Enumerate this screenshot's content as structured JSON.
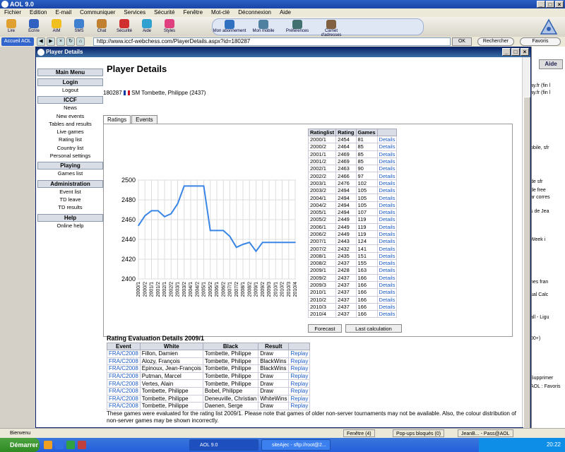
{
  "app": {
    "title": "AOL 9.0"
  },
  "menu": [
    "Fichier",
    "Edition",
    "E-mail",
    "Communiquer",
    "Services",
    "Sécurité",
    "Fenêtre",
    "Mot-clé",
    "Déconnexion",
    "Aide"
  ],
  "toolbar": [
    {
      "label": "Lire",
      "color": "#e0a030"
    },
    {
      "label": "Ecrire",
      "color": "#3060c0"
    },
    {
      "label": "AIM",
      "color": "#f0c020"
    },
    {
      "label": "SMS",
      "color": "#4080d0"
    },
    {
      "label": "Chat",
      "color": "#c08030"
    },
    {
      "label": "Sécurité",
      "color": "#d03030"
    },
    {
      "label": "Aide",
      "color": "#30a0d0"
    },
    {
      "label": "Styles",
      "color": "#e04080"
    }
  ],
  "toolbar2": [
    {
      "label": "Mon abonnement",
      "color": "#3070c0"
    },
    {
      "label": "Mon mobile",
      "color": "#5080a0"
    },
    {
      "label": "Préférences",
      "color": "#407070"
    },
    {
      "label": "Carnet d'adresses",
      "color": "#806040"
    }
  ],
  "address": {
    "accueil": "Accueil AOL",
    "url": "http://www.iccf-webchess.com/PlayerDetails.aspx?id=180287",
    "ok": "OK",
    "search": "Rechercher",
    "favs": "Favoris"
  },
  "window": {
    "title": "Player Details"
  },
  "nav": [
    {
      "type": "header",
      "label": "Main Menu"
    },
    {
      "type": "header",
      "label": "Login"
    },
    {
      "type": "item",
      "label": "Logout"
    },
    {
      "type": "header",
      "label": "ICCF"
    },
    {
      "type": "item",
      "label": "News"
    },
    {
      "type": "item",
      "label": "New events"
    },
    {
      "type": "item",
      "label": "Tables and results"
    },
    {
      "type": "item",
      "label": "Live games"
    },
    {
      "type": "item",
      "label": "Rating list"
    },
    {
      "type": "item",
      "label": "Country list"
    },
    {
      "type": "item",
      "label": "Personal settings"
    },
    {
      "type": "header",
      "label": "Playing"
    },
    {
      "type": "item",
      "label": "Games list"
    },
    {
      "type": "header",
      "label": "Administration"
    },
    {
      "type": "item",
      "label": "Event list"
    },
    {
      "type": "item",
      "label": "TD leave"
    },
    {
      "type": "item",
      "label": "TD results"
    },
    {
      "type": "header",
      "label": "Help"
    },
    {
      "type": "item",
      "label": "Online help"
    }
  ],
  "page": {
    "title": "Player Details",
    "player_id": "180287",
    "player_name": "SM Tombette, Philippe (2437)",
    "tabs": [
      "Ratings",
      "Events"
    ],
    "forecast": "Forecast",
    "last_calc": "Last calculation",
    "eval_title": "Rating Evaluation Details 2009/1",
    "eval_note": "These games were evaluated for the rating list 2009/1. Please note that games of older non-server tournaments may not be available. Also, the colour distribution of non-server games may be shown incorrectly."
  },
  "rating_table": {
    "headers": [
      "Ratinglist",
      "Rating",
      "Games",
      ""
    ],
    "link": "Details",
    "rows": [
      [
        "2000/1",
        "2454",
        "81"
      ],
      [
        "2000/2",
        "2464",
        "85"
      ],
      [
        "2001/1",
        "2469",
        "85"
      ],
      [
        "2001/2",
        "2469",
        "85"
      ],
      [
        "2002/1",
        "2463",
        "90"
      ],
      [
        "2002/2",
        "2466",
        "97"
      ],
      [
        "2003/1",
        "2476",
        "102"
      ],
      [
        "2003/2",
        "2494",
        "105"
      ],
      [
        "2004/1",
        "2494",
        "105"
      ],
      [
        "2004/2",
        "2494",
        "105"
      ],
      [
        "2005/1",
        "2494",
        "107"
      ],
      [
        "2005/2",
        "2449",
        "119"
      ],
      [
        "2006/1",
        "2449",
        "119"
      ],
      [
        "2006/2",
        "2449",
        "119"
      ],
      [
        "2007/1",
        "2443",
        "124"
      ],
      [
        "2007/2",
        "2432",
        "141"
      ],
      [
        "2008/1",
        "2435",
        "151"
      ],
      [
        "2008/2",
        "2437",
        "155"
      ],
      [
        "2009/1",
        "2428",
        "163"
      ],
      [
        "2009/2",
        "2437",
        "166"
      ],
      [
        "2009/3",
        "2437",
        "166"
      ],
      [
        "2010/1",
        "2437",
        "166"
      ],
      [
        "2010/2",
        "2437",
        "166"
      ],
      [
        "2010/3",
        "2437",
        "166"
      ],
      [
        "2010/4",
        "2437",
        "166"
      ]
    ]
  },
  "chart_data": {
    "type": "line",
    "x": [
      "2000/1",
      "2000/2",
      "2001/1",
      "2001/2",
      "2002/1",
      "2002/2",
      "2003/1",
      "2003/2",
      "2004/1",
      "2004/2",
      "2005/1",
      "2005/2",
      "2006/1",
      "2006/2",
      "2007/1",
      "2007/2",
      "2008/1",
      "2008/2",
      "2009/1",
      "2009/2",
      "2009/3",
      "2010/1",
      "2010/2",
      "2010/3",
      "2010/4"
    ],
    "series": [
      {
        "values": [
          2454,
          2464,
          2469,
          2469,
          2463,
          2466,
          2476,
          2494,
          2494,
          2494,
          2494,
          2449,
          2449,
          2449,
          2443,
          2432,
          2435,
          2437,
          2428,
          2437,
          2437,
          2437,
          2437,
          2437,
          2437
        ]
      }
    ],
    "yticks": [
      2400,
      2420,
      2440,
      2460,
      2480,
      2500
    ],
    "ylim": [
      2400,
      2500
    ],
    "grid": true,
    "color": "#3a86e6"
  },
  "eval_table": {
    "headers": [
      "Event",
      "White",
      "Black",
      "Result",
      ""
    ],
    "link": "Replay",
    "rows": [
      [
        "FRA/C2008",
        "Fillon, Damien",
        "Tombette, Philippe",
        "Draw"
      ],
      [
        "FRA/C2008",
        "Alozy, François",
        "Tombette, Philippe",
        "BlackWins"
      ],
      [
        "FRA/C2008",
        "Epinoux, Jean-François",
        "Tombette, Philippe",
        "BlackWins"
      ],
      [
        "FRA/C2008",
        "Putman, Marcel",
        "Tombette, Philippe",
        "Draw"
      ],
      [
        "FRA/C2008",
        "Vertes, Alain",
        "Tombette, Philippe",
        "Draw"
      ],
      [
        "FRA/C2008",
        "Tombette, Philippe",
        "Bobel, Philippe",
        "Draw"
      ],
      [
        "FRA/C2008",
        "Tombette, Philippe",
        "Deneuville, Christian",
        "WhiteWins"
      ],
      [
        "FRA/C2008",
        "Tombette, Philippe",
        "Daenen, Serge",
        "Draw"
      ]
    ]
  },
  "rightpane": {
    "aide": "Aide",
    "lines": [
      "ay.fr (fin l",
      "ay.fr (fin l",
      "obile, sfr",
      "de sfr",
      "de free",
      "ar corres",
      "s de Jea",
      "Week i",
      "hes fran",
      "ual Calc",
      "all - Ligu",
      "00+)",
      "Supprimer",
      "AOL : Favoris"
    ]
  },
  "status": {
    "left": "Bienvenu",
    "fenetre": "Fenêtre (4)",
    "popups": "Pop-ups bloqués (0)",
    "user": "JeanB... - Pass@AOL"
  },
  "taskbar": {
    "start": "Démarrer",
    "tasks": [
      "AOL 9.0",
      "siteAjec - sftp://root@2..."
    ],
    "clock": "20:22"
  }
}
